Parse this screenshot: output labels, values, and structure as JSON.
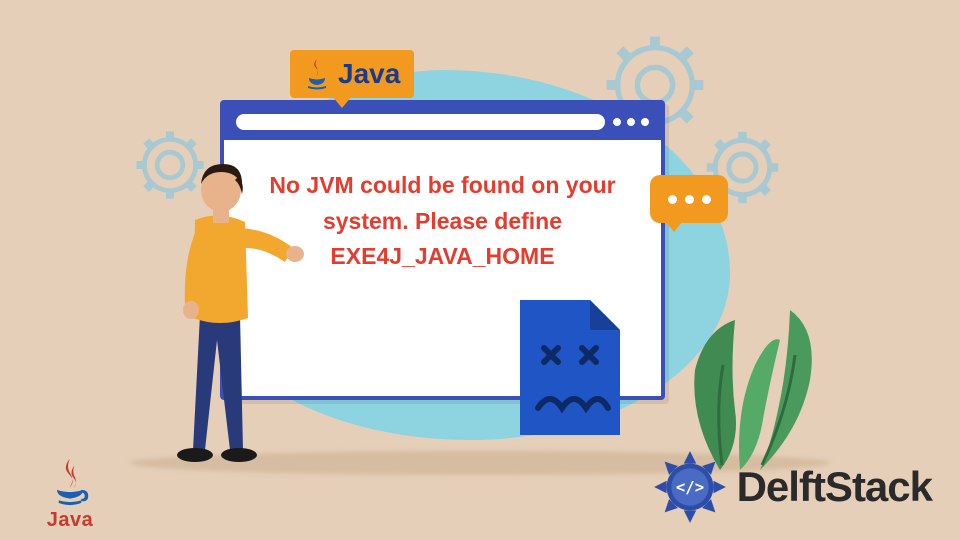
{
  "java_badge": {
    "label": "Java"
  },
  "error_message": "No JVM could be found on your system. Please define EXE4J_JAVA_HOME",
  "bottom_left": {
    "label": "Java"
  },
  "brand": {
    "name": "DelftStack"
  },
  "colors": {
    "bg": "#e5cfb8",
    "blob": "#8dd3e0",
    "browser_frame": "#3b4fb8",
    "accent_orange": "#f29a1f",
    "error_red": "#e43c2f",
    "plant_green": "#4a9a5e"
  }
}
